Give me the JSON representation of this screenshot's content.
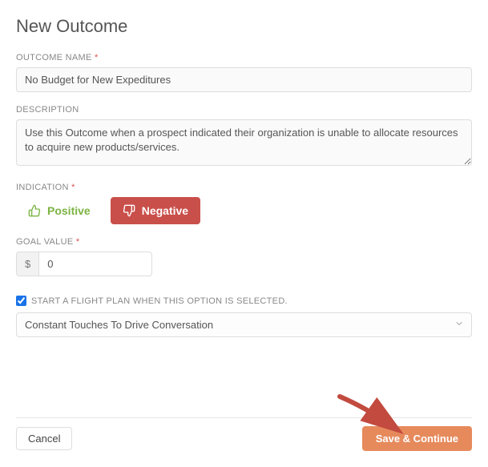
{
  "title": "New Outcome",
  "fields": {
    "outcome_name": {
      "label": "OUTCOME NAME",
      "required": "*",
      "value": "No Budget for New Expeditures"
    },
    "description": {
      "label": "DESCRIPTION",
      "value": "Use this Outcome when a prospect indicated their organization is unable to allocate resources to acquire new products/services."
    },
    "indication": {
      "label": "INDICATION",
      "required": "*",
      "positive_label": "Positive",
      "negative_label": "Negative"
    },
    "goal_value": {
      "label": "GOAL VALUE",
      "required": "*",
      "currency": "$",
      "value": "0"
    },
    "flight_plan": {
      "checkbox_label": "START A FLIGHT PLAN WHEN THIS OPTION IS SELECTED.",
      "selected_option": "Constant Touches To Drive Conversation"
    }
  },
  "footer": {
    "cancel_label": "Cancel",
    "save_label": "Save & Continue"
  }
}
